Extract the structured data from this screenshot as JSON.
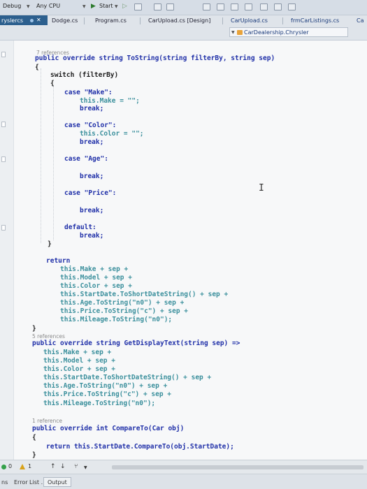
{
  "toolbar": {
    "config": "Debug",
    "platform": "Any CPU",
    "start": "Start"
  },
  "tabs": {
    "active": "ryslercs",
    "items": [
      "Dodge.cs",
      "Program.cs",
      "CarUpload.cs [Design]",
      "CarUpload.cs",
      "frmCarListings.cs",
      "Ca"
    ],
    "nav_member": "CarDealership.Chrysler"
  },
  "code": {
    "ref1": "7 references",
    "ref2": "5 references",
    "ref3": "1 reference",
    "lines": [
      "public override string ToString(string filterBy, string sep)",
      "{",
      "switch (filterBy)",
      "{",
      "case \"Make\":",
      "this.Make = \"\";",
      "break;",
      "case \"Color\":",
      "this.Color = \"\";",
      "break;",
      "case \"Age\":",
      "break;",
      "case \"Price\":",
      "break;",
      "default:",
      "break;",
      "}",
      "return",
      "this.Make + sep +",
      "this.Model + sep +",
      "this.Color + sep +",
      "this.StartDate.ToShortDateString() + sep +",
      "this.Age.ToString(\"n0\") + sep +",
      "this.Price.ToString(\"c\") + sep +",
      "this.Mileage.ToString(\"n0\");",
      "}",
      "public override string GetDisplayText(string sep) =>",
      "this.Make + sep +",
      "this.Model + sep +",
      "this.Color + sep +",
      "this.StartDate.ToShortDateString() + sep +",
      "this.Age.ToString(\"n0\") + sep +",
      "this.Price.ToString(\"c\") + sep +",
      "this.Mileage.ToString(\"n0\");",
      "public override int CompareTo(Car obj)",
      "{",
      "return this.StartDate.CompareTo(obj.StartDate);",
      "}"
    ]
  },
  "status": {
    "errors": "0",
    "warnings": "1"
  },
  "bottom_tabs": {
    "left": "ns",
    "error_list": "Error List ...",
    "output": "Output"
  },
  "colors": {
    "keyword": "#1f2fa8",
    "string": "#a33a2c",
    "this": "#3a8f9c",
    "active_tab": "#2c5f8e"
  }
}
